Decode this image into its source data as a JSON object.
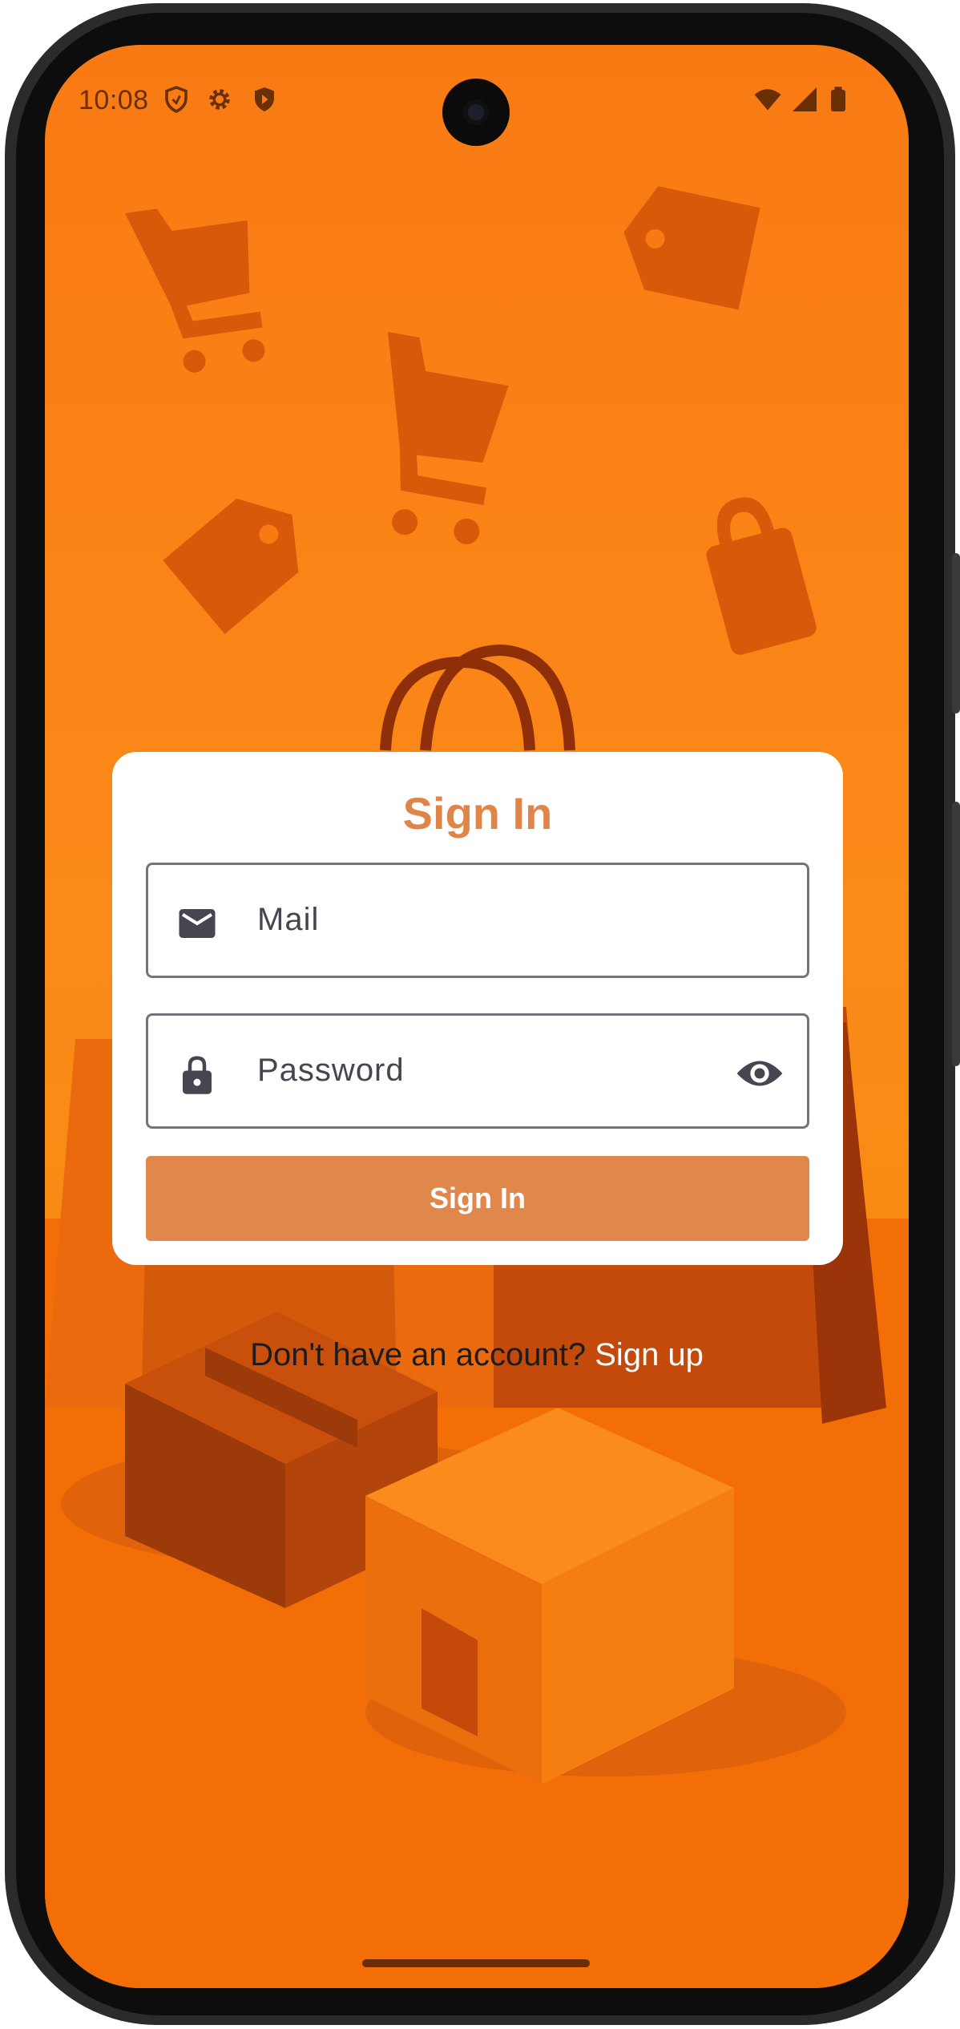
{
  "status_bar": {
    "time": "10:08",
    "left_icons": [
      "shield-outline-icon",
      "gear-icon",
      "shield-play-icon"
    ],
    "right_icons": [
      "wifi-icon",
      "cellular-signal-icon",
      "battery-icon"
    ]
  },
  "background": {
    "illustration": [
      "shopping-cart-icon",
      "price-tag-icon",
      "padlock-icon",
      "shopping-bag-icon",
      "cardboard-box-icon"
    ]
  },
  "sign_in_card": {
    "title": "Sign In",
    "mail_field": {
      "placeholder": "Mail",
      "icon": "mail-icon"
    },
    "password_field": {
      "placeholder": "Password",
      "icon": "lock-icon",
      "toggle_icon": "eye-icon"
    },
    "submit_label": "Sign In"
  },
  "signup_prompt": {
    "text": "Don't have an account?",
    "link": "Sign up"
  },
  "colors": {
    "accent": "#e0854a",
    "background_orange": "#f97a13",
    "card": "#ffffff"
  }
}
